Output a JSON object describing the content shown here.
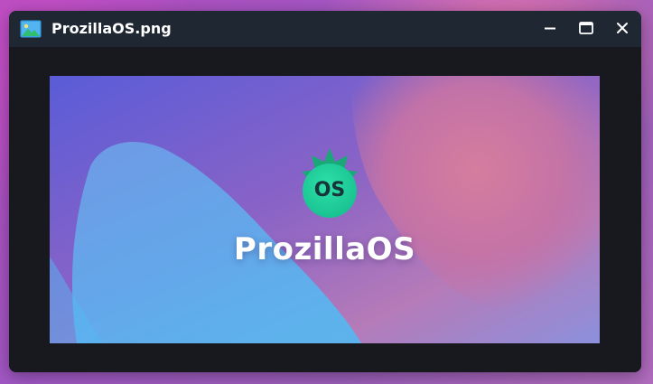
{
  "window": {
    "title": "ProzillaOS.png",
    "icon": "image-file-icon",
    "controls": {
      "minimize_icon": "minimize-icon",
      "maximize_icon": "maximize-icon",
      "close_icon": "close-icon"
    }
  },
  "image": {
    "logo_text": "ProzillaOS",
    "badge_text": "OS"
  },
  "colors": {
    "titlebar": "#1f2733",
    "window_body": "#17191e",
    "badge_green": "#1ed3a0",
    "desktop_purple": "#a058c4"
  }
}
